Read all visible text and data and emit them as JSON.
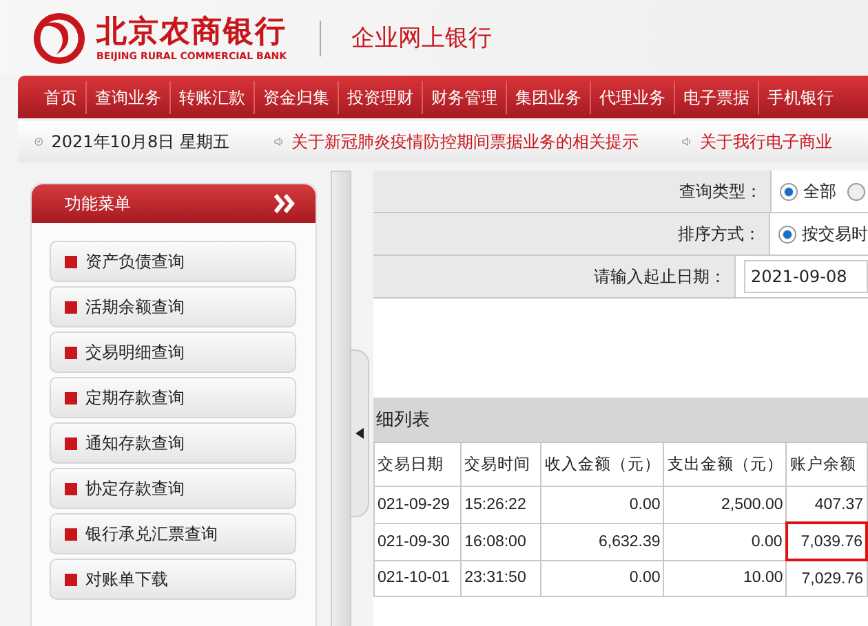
{
  "header": {
    "bank_name": "北京农商银行",
    "bank_name_en": "BEIJING RURAL COMMERCIAL BANK",
    "product": "企业网上银行"
  },
  "nav": {
    "items": [
      "首页",
      "查询业务",
      "转账汇款",
      "资金归集",
      "投资理财",
      "财务管理",
      "集团业务",
      "代理业务",
      "电子票据",
      "手机银行"
    ]
  },
  "info_bar": {
    "date": "2021年10月8日 星期五",
    "notices": [
      "关于新冠肺炎疫情防控期间票据业务的相关提示",
      "关于我行电子商业"
    ]
  },
  "sidebar": {
    "title": "功能菜单",
    "items": [
      "资产负债查询",
      "活期余额查询",
      "交易明细查询",
      "定期存款查询",
      "通知存款查询",
      "协定存款查询",
      "银行承兑汇票查询",
      "对账单下载"
    ]
  },
  "query_form": [
    {
      "kind": "radio",
      "label": "查询类型：",
      "options": [
        {
          "label": "全部",
          "selected": true
        },
        {
          "selected": false
        }
      ]
    },
    {
      "kind": "radio",
      "label": "排序方式：",
      "options": [
        {
          "label": "按交易时",
          "selected": true
        }
      ]
    },
    {
      "kind": "date",
      "label": "请输入起止日期：",
      "value": "2021-09-08"
    }
  ],
  "table": {
    "title": "细列表",
    "columns": [
      "交易日期",
      "交易时间",
      "收入金额（元）",
      "支出金额（元）",
      "账户余额"
    ],
    "rows": [
      {
        "cells": [
          "021-09-29",
          "15:26:22",
          "0.00",
          "2,500.00",
          "407.37"
        ],
        "highlighted": false
      },
      {
        "cells": [
          "021-09-30",
          "16:08:00",
          "6,632.39",
          "0.00",
          "7,039.76"
        ],
        "highlighted": true
      },
      {
        "cells": [
          "021-10-01",
          "23:31:50",
          "0.00",
          "10.00",
          "7,029.76"
        ],
        "highlighted": false
      }
    ]
  }
}
